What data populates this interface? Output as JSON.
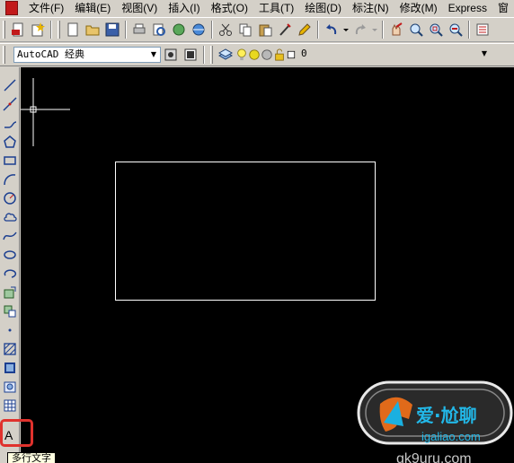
{
  "menu": {
    "items": [
      "文件(F)",
      "编辑(E)",
      "视图(V)",
      "插入(I)",
      "格式(O)",
      "工具(T)",
      "绘图(D)",
      "标注(N)",
      "修改(M)",
      "Express",
      "窗"
    ]
  },
  "toolbar": {
    "workspace": "AutoCAD 经典",
    "layer": "0"
  },
  "tooltip": {
    "text": "多行文字"
  },
  "watermark": {
    "brand": "爱·尬聊",
    "url": "igaliao.com",
    "bottom_text": "qk9uru.com"
  },
  "colors": {
    "canvas": "#000000",
    "highlight": "#e0322d",
    "rectangle": "#ffffff",
    "crosshair": "#ffffff"
  },
  "left_toolbar_icons": [
    "line-icon",
    "construction-line-icon",
    "polyline-icon",
    "polygon-icon",
    "rectangle-icon",
    "arc-icon",
    "circle-icon",
    "revision-cloud-icon",
    "spline-icon",
    "ellipse-icon",
    "ellipse-arc-icon",
    "insert-block-icon",
    "make-block-icon",
    "point-icon",
    "hatch-icon",
    "gradient-icon",
    "region-icon",
    "table-icon",
    "multiline-text-icon"
  ]
}
